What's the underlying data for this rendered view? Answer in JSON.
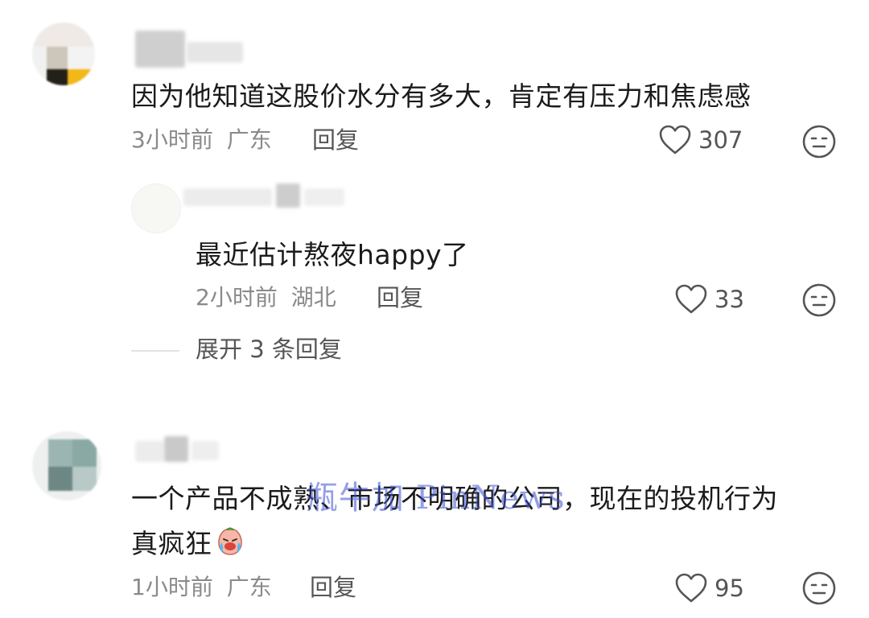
{
  "comments": [
    {
      "text": "因为他知道这股价水分有多大，肯定有压力和焦虑感",
      "time": "3小时前",
      "location": "广东",
      "reply_label": "回复",
      "likes": "307",
      "replies": [
        {
          "text": "最近估计熬夜happy了",
          "time": "2小时前",
          "location": "湖北",
          "reply_label": "回复",
          "likes": "33"
        }
      ],
      "expand_label": "展开 3 条回复"
    },
    {
      "text_line1": "一个产品不成熟、市场不明确的公司，现在的投机行为",
      "text_line2": "真疯狂",
      "time": "1小时前",
      "location": "广东",
      "reply_label": "回复",
      "likes": "95"
    }
  ],
  "watermark": "瓶牛加 PinNews",
  "icons": {
    "like": "heart-outline-icon",
    "dislike": "neutral-face-icon",
    "emoji": "crying-laughing-emoji-icon"
  },
  "colors": {
    "text": "#1b1b1b",
    "meta": "#8a8a8a",
    "action": "#555555",
    "watermark": "#3c50d2"
  }
}
